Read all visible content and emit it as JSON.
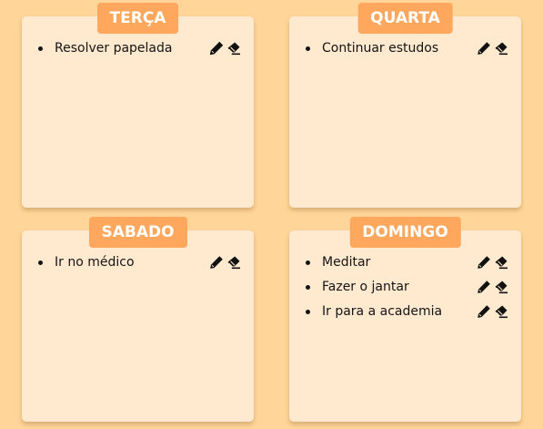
{
  "days": [
    {
      "title": "TERÇA",
      "tasks": [
        "Resolver papelada"
      ]
    },
    {
      "title": "QUARTA",
      "tasks": [
        "Continuar estudos"
      ]
    },
    {
      "title": "SABADO",
      "tasks": [
        "Ir no médico"
      ]
    },
    {
      "title": "DOMINGO",
      "tasks": [
        "Meditar",
        "Fazer o jantar",
        "Ir para a academia"
      ]
    }
  ],
  "icons": {
    "edit": "pencil-icon",
    "delete": "eraser-icon"
  },
  "colors": {
    "background": "#ffd59a",
    "card": "#ffe9cf",
    "header": "#ffa75c"
  }
}
